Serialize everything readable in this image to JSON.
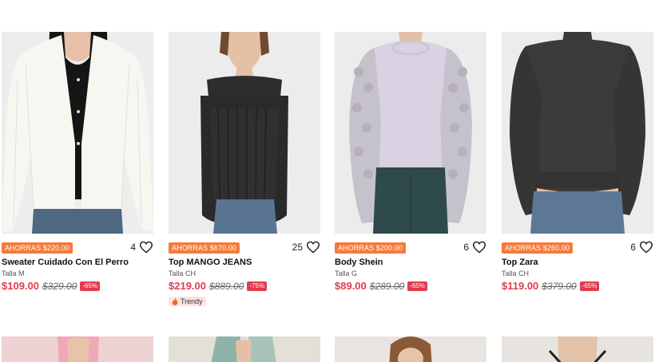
{
  "products": [
    {
      "savings": "AHORRAS $220.00",
      "likes": "4",
      "title": "Sweater Cuidado Con El Perro",
      "size": "Talla M",
      "price": "$109.00",
      "old_price": "$329.00",
      "discount": "-65%",
      "tag": "",
      "image": "woman-white-cardigan-black-top"
    },
    {
      "savings": "AHORRAS $670.00",
      "likes": "25",
      "title": "Top MANGO JEANS",
      "size": "Talla CH",
      "price": "$219.00",
      "old_price": "$889.00",
      "discount": "-75%",
      "tag": "Trendy",
      "image": "woman-black-off-shoulder-top"
    },
    {
      "savings": "AHORRAS $200.00",
      "likes": "6",
      "title": "Body Shein",
      "size": "Talla G",
      "price": "$89.00",
      "old_price": "$289.00",
      "discount": "-65%",
      "tag": "",
      "image": "woman-lilac-bubble-sleeve-bodysuit"
    },
    {
      "savings": "AHORRAS $260.00",
      "likes": "6",
      "title": "Top Zara",
      "size": "Talla CH",
      "price": "$119.00",
      "old_price": "$379.00",
      "discount": "-65%",
      "tag": "",
      "image": "woman-charcoal-mock-neck-sweater"
    }
  ],
  "icons": {
    "like": "heart-outline-icon",
    "trend": "flame-icon"
  },
  "colors": {
    "savings_badge": "#f47b3a",
    "price": "#e23b4f",
    "trendy_bg": "#fde3e1"
  }
}
